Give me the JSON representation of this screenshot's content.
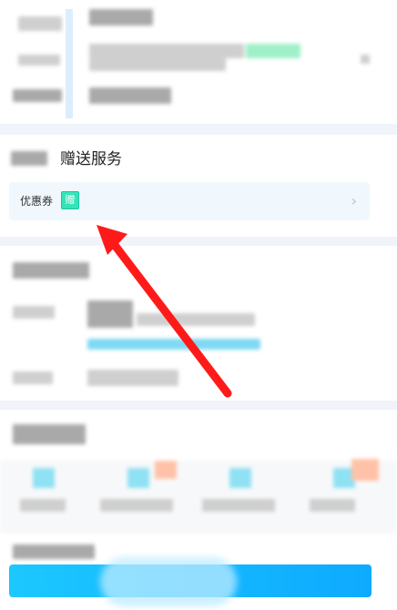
{
  "gift_section": {
    "title": "赠送服务",
    "coupon_label": "优惠券",
    "coupon_tag": "赠",
    "chevron": "›"
  },
  "annotation": {
    "arrow_color": "#ff1a1a"
  },
  "icons": {
    "chevron": "chevron-right-icon",
    "arrow": "red-arrow-annotation"
  },
  "colors": {
    "accent": "#0eaaff",
    "tag_green": "#35e3b8",
    "section_bg": "#f1f3fa"
  }
}
